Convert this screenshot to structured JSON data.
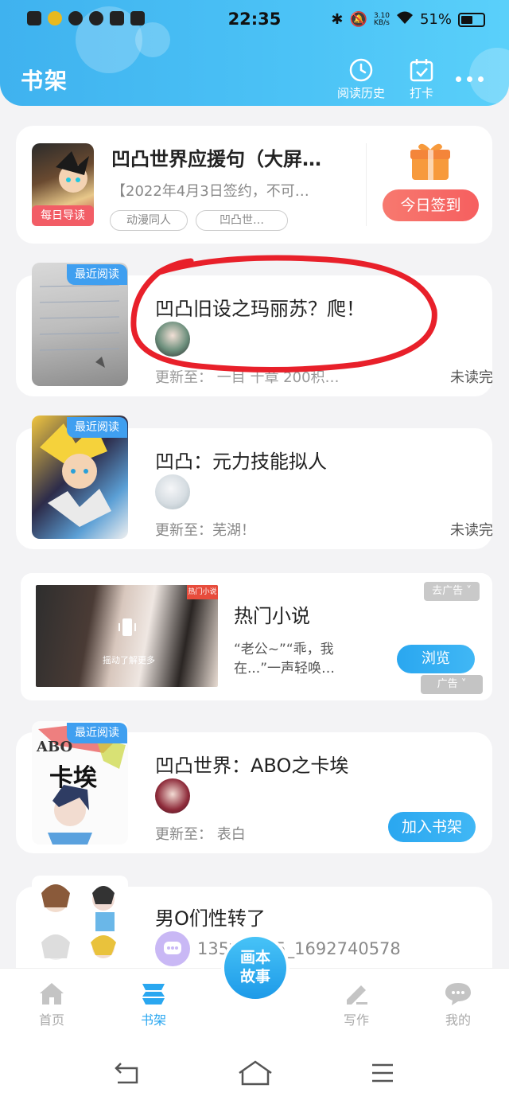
{
  "status_bar": {
    "time": "22:35",
    "net_speed_value": "3.10",
    "net_speed_unit": "KB/s",
    "battery": "51%"
  },
  "header": {
    "title": "书架",
    "history_label": "阅读历史",
    "checkin_label": "打卡"
  },
  "daily_card": {
    "badge": "每日导读",
    "title": "凹凸世界应援句（大屏…",
    "desc": "【2022年4月3日签约，不可…",
    "tags": [
      "动漫同人",
      "凹凸世…"
    ],
    "signin_label": "今日签到"
  },
  "books": [
    {
      "badge": "最近阅读",
      "title": "凹凸旧设之玛丽苏？爬！",
      "update": "更新至：  一目  十章  200积…",
      "status": "未读完"
    },
    {
      "badge": "最近阅读",
      "title": "凹凸：元力技能拟人",
      "update": "更新至：芜湖！",
      "status": "未读完"
    },
    {
      "badge": "最近阅读",
      "title": "凹凸世界：ABO之卡埃",
      "update": "更新至：  表白",
      "action": "加入书架",
      "cover_text_top": "ABO",
      "cover_text_main": "卡埃"
    },
    {
      "title": "男O们性转了",
      "author": "135***155_1692740578"
    }
  ],
  "ad": {
    "close_label": "去广告",
    "image_caption": "摇动了解更多",
    "image_corner": "热门小说",
    "title": "热门小说",
    "desc": "“老公~”“乖，我在...”一声轻唤…",
    "button": "浏览",
    "label": "广告"
  },
  "bottom_nav": {
    "home": "首页",
    "shelf": "书架",
    "center_line1": "画本",
    "center_line2": "故事",
    "write": "写作",
    "mine": "我的"
  },
  "colors": {
    "accent": "#3fb2ef",
    "signin": "#f65f5f",
    "annotation": "#e8202a"
  }
}
